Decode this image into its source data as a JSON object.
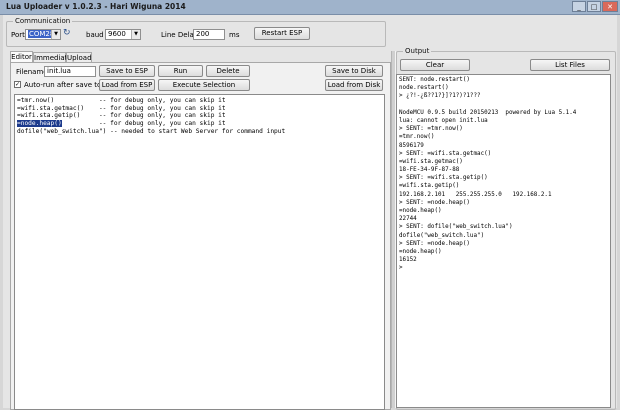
{
  "window": {
    "title": "Lua Uploader v 1.0.2.3 - Hari Wiguna 2014",
    "min": "_",
    "max": "□",
    "close": "✕"
  },
  "communication": {
    "group_label": "Communication",
    "port_label": "Port",
    "port_value": "COM28",
    "baud_label": "baud",
    "baud_value": "9600",
    "line_delay_label": "Line Delay",
    "line_delay_value": "200",
    "ms_label": "ms",
    "restart_button": "Restart ESP",
    "refresh_icon": "refresh-icon"
  },
  "tabs": [
    {
      "label": "Editor"
    },
    {
      "label": "Immediate"
    },
    {
      "label": "Upload"
    }
  ],
  "editor_panel": {
    "filename_label": "Filename:",
    "filename_value": "init.lua",
    "save_to_esp": "Save to ESP",
    "run": "Run",
    "delete": "Delete",
    "save_to_disk": "Save to Disk",
    "autorun_label": "Auto-run after save to ESP",
    "autorun_checked": "✓",
    "load_from_esp": "Load from ESP",
    "execute_selection": "Execute Selection",
    "load_from_disk": "Load from Disk",
    "code": [
      {
        "text": "=tmr.now()            -- for debug only, you can skip it"
      },
      {
        "text": "=wifi.sta.getmac()    -- for debug only, you can skip it"
      },
      {
        "text": "=wifi.sta.getip()     -- for debug only, you can skip it"
      },
      {
        "pre": "",
        "hl": "=node.heap()",
        "post": "          -- for debug only, you can skip it"
      },
      {
        "text": "dofile(\"web_switch.lua\") -- needed to start Web Server for command input"
      }
    ]
  },
  "output": {
    "group_label": "Output",
    "clear": "Clear",
    "list_files": "List Files",
    "lines": [
      "SENT: node.restart()",
      "node.restart()",
      "> ¿?!-¿ß??1?}]?1?)?1???",
      "",
      "NodeMCU 0.9.5 build 20150213  powered by Lua 5.1.4",
      "lua: cannot open init.lua",
      "> SENT: =tmr.now()",
      "=tmr.now()",
      "8596179",
      "> SENT: =wifi.sta.getmac()",
      "=wifi.sta.getmac()",
      "18-FE-34-9F-87-88",
      "> SENT: =wifi.sta.getip()",
      "=wifi.sta.getip()",
      "192.168.2.101   255.255.255.0   192.168.2.1",
      "> SENT: =node.heap()",
      "=node.heap()",
      "22744",
      "> SENT: dofile(\"web_switch.lua\")",
      "dofile(\"web_switch.lua\")",
      "> SENT: =node.heap()",
      "=node.heap()",
      "16152",
      ">"
    ]
  }
}
